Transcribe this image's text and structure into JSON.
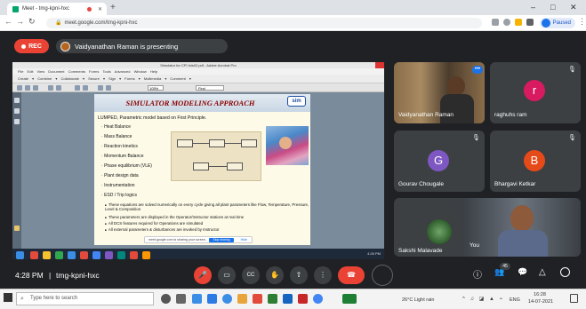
{
  "browser": {
    "tab_title": "Meet - tmg-kpni-hxc",
    "new_tab": "+",
    "url": "meet.google.com/tmg-kpni-hxc",
    "paused_label": "Paused",
    "win_min": "–",
    "win_max": "□",
    "win_close": "✕"
  },
  "meet": {
    "rec_label": "REC",
    "presenting_text": "Vaidyanathan Raman is presenting",
    "time": "4:28 PM",
    "separator": "|",
    "meeting_code": "tmg-kpni-hxc",
    "participant_count": "45"
  },
  "presented_window": {
    "title": "Simulator for CPI Isis02.pdf - Adobe Acrobat Pro",
    "menu": "File Edit View Document Comments Forms Tools Advanced Window Help",
    "toolbar": "Create ▾  Combine ▾  Collaborate ▾  Secure ▾  Sign ▾  Forms ▾  Multimedia ▾  Comment ▾",
    "zoom": "105%",
    "find": "Find",
    "taskbar_time": "4:26 PM"
  },
  "slide": {
    "title": "SIMULATOR MODELING APPROACH",
    "logo": "sim",
    "subtitle": "LUMPED, Parametric model based on First Principle.",
    "items": [
      "Heat Balance",
      "Mass Balance",
      "Reaction kinetics",
      "Momentum Balance",
      "Phase equilibrium (VLE)",
      "Plant design data",
      "Instrumentation",
      "ESD / Trip logics"
    ],
    "bullets": [
      "These equations are solved numerically on every cycle giving all plant parameters like Flow, Temperature, Pressure, Level & Composition",
      "These parameters are displayed in the Operator/Instructor stations at real time",
      "All DCS features required for Operations are simulated",
      "All external parameters & disturbances are invoked by Instructor"
    ],
    "share_note": "meet.google.com is sharing your screen.",
    "stop_sharing": "Stop sharing",
    "hide": "Hide"
  },
  "participants": [
    {
      "name": "Vaidyanathan Raman",
      "initial": "",
      "color": ""
    },
    {
      "name": "raghuhs ram",
      "initial": "r",
      "color": "#d81b60"
    },
    {
      "name": "Gourav Chougale",
      "initial": "G",
      "color": "#7e57c2"
    },
    {
      "name": "Bhargavi Ketkar",
      "initial": "B",
      "color": "#e64a19"
    },
    {
      "name": "Sakshi Malavade",
      "initial": "",
      "color": ""
    },
    {
      "name": "You",
      "initial": "",
      "color": ""
    }
  ],
  "controls": {
    "mic": "🎤",
    "camera": "▭",
    "captions": "CC",
    "raise_hand": "✋",
    "present": "⇧",
    "more": "⋮",
    "end_call": "☎",
    "info": "ⓘ",
    "people": "👥",
    "chat": "💬",
    "activities": "△"
  },
  "taskbar": {
    "search_placeholder": "Type here to search",
    "weather": "26°C  Light rain",
    "lang": "ENG",
    "time": "16:28",
    "date": "14-07-2021"
  },
  "colors": {
    "meet_bg": "#202124",
    "tile_bg": "#3c4043",
    "rec_red": "#ea4335",
    "end_red": "#ea4335",
    "slide_title": "#8b0000"
  }
}
